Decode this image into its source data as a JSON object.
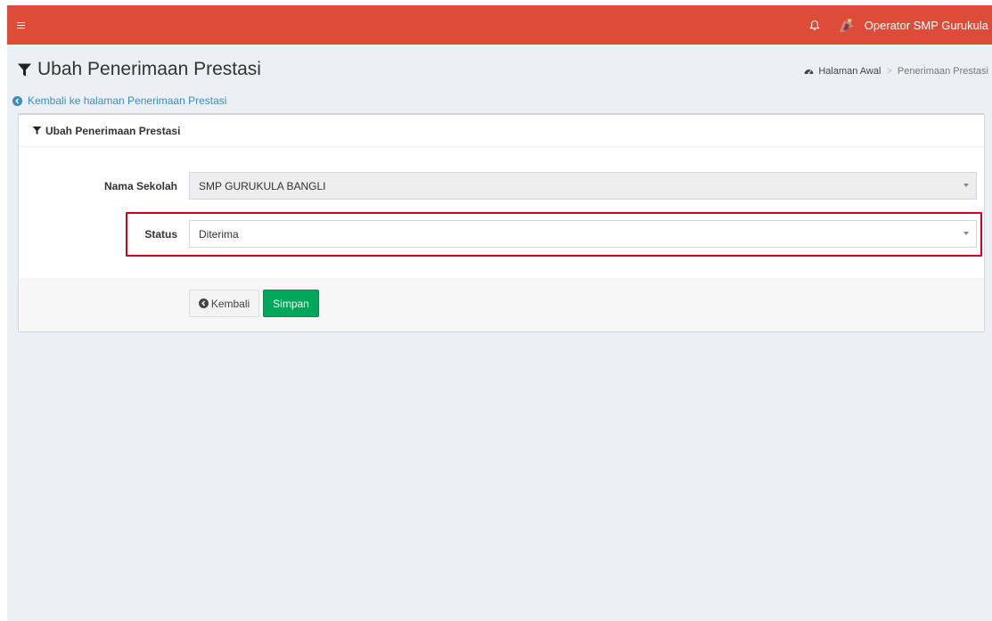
{
  "header": {
    "user_name": "Operator SMP Gurukula",
    "icons": [
      "menu-icon",
      "bell-icon",
      "avatar"
    ],
    "brand_color": "#dd4b39"
  },
  "page": {
    "title": "Ubah Penerimaan Prestasi",
    "breadcrumb": {
      "home": "Halaman Awal",
      "separator": ">",
      "current": "Penerimaan Prestasi"
    },
    "back_link": "Kembali ke halaman Penerimaan Prestasi"
  },
  "form": {
    "box_title": "Ubah Penerimaan Prestasi",
    "fields": {
      "school": {
        "label": "Nama Sekolah",
        "value": "SMP GURUKULA BANGLI",
        "disabled": true
      },
      "status": {
        "label": "Status",
        "value": "Diterima"
      }
    },
    "buttons": {
      "back": "Kembali",
      "save": "Simpan"
    },
    "highlight_color": "#d0021b",
    "save_color": "#00a65a"
  }
}
